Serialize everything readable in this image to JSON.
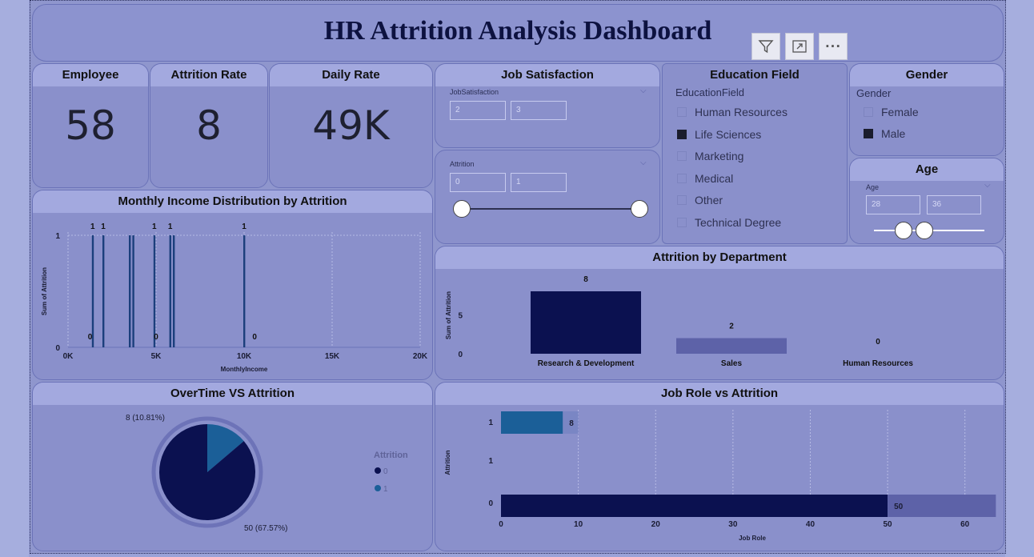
{
  "header": {
    "title": "HR Attrition Analysis Dashboard"
  },
  "toolbar": {
    "filter_icon": "filter-icon",
    "focus_icon": "expand-icon",
    "more_icon": "more-options-icon",
    "more_glyph": "···"
  },
  "kpis": [
    {
      "label": "Employee",
      "value": "58"
    },
    {
      "label": "Attrition Rate",
      "value": "8"
    },
    {
      "label": "Daily Rate",
      "value": "49K"
    }
  ],
  "job_satisfaction": {
    "title": "Job Satisfaction",
    "field_label": "JobSatisfaction",
    "min": "2",
    "max": "3"
  },
  "attrition_slicer": {
    "field_label": "Attrition",
    "min": "0",
    "max": "1"
  },
  "education": {
    "title": "Education Field",
    "field_label": "EducationField",
    "options": [
      {
        "label": "Human Resources",
        "checked": false
      },
      {
        "label": "Life Sciences",
        "checked": true
      },
      {
        "label": "Marketing",
        "checked": false
      },
      {
        "label": "Medical",
        "checked": false
      },
      {
        "label": "Other",
        "checked": false
      },
      {
        "label": "Technical Degree",
        "checked": false
      }
    ]
  },
  "gender": {
    "title": "Gender",
    "field_label": "Gender",
    "options": [
      {
        "label": "Female",
        "checked": false
      },
      {
        "label": "Male",
        "checked": true
      }
    ]
  },
  "age": {
    "title": "Age",
    "field_label": "Age",
    "min": "28",
    "max": "36"
  },
  "chart_data": [
    {
      "id": "income",
      "type": "bar",
      "title": "Monthly Income Distribution by Attrition",
      "xlabel": "MonthlyIncome",
      "ylabel": "Sum of Attrition",
      "xlim": [
        0,
        20000
      ],
      "ylim": [
        0,
        1
      ],
      "x_ticks": [
        "0K",
        "5K",
        "10K",
        "15K",
        "20K"
      ],
      "y_ticks": [
        "0",
        "1"
      ],
      "grid": true,
      "bars": [
        {
          "x": 1400,
          "value": 1,
          "label": "1"
        },
        {
          "x": 2000,
          "value": 1,
          "label": "1"
        },
        {
          "x": 3500,
          "value": 1,
          "label": ""
        },
        {
          "x": 3700,
          "value": 1,
          "label": ""
        },
        {
          "x": 4900,
          "value": 1,
          "label": "1"
        },
        {
          "x": 5800,
          "value": 1,
          "label": "1"
        },
        {
          "x": 6000,
          "value": 1,
          "label": ""
        },
        {
          "x": 10000,
          "value": 1,
          "label": "1"
        }
      ],
      "zero_labels": [
        {
          "x": 1250,
          "label": "0"
        },
        {
          "x": 5000,
          "label": "0"
        },
        {
          "x": 10600,
          "label": "0"
        }
      ]
    },
    {
      "id": "department",
      "type": "bar",
      "title": "Attrition by Department",
      "ylabel": "Sum of Attrition",
      "categories": [
        "Research & Development",
        "Sales",
        "Human Resources"
      ],
      "values": [
        8,
        2,
        0
      ],
      "ylim": [
        0,
        8
      ],
      "y_ticks": [
        0,
        5
      ],
      "colors": [
        "#0b1150",
        "#5d62a8",
        "#8a90cb"
      ]
    },
    {
      "id": "overtime",
      "type": "pie",
      "title": "OverTime VS Attrition",
      "legend_title": "Attrition",
      "legend_placement": "right",
      "slices": [
        {
          "name": "0",
          "value": 50,
          "label": "50 (67.57%)",
          "color": "#0b1150"
        },
        {
          "name": "1",
          "value": 8,
          "label": "8 (10.81%)",
          "color": "#1b5f98"
        }
      ]
    },
    {
      "id": "jobrole",
      "type": "bar",
      "orientation": "horizontal",
      "title": "Job Role vs Attrition",
      "xlabel": "Job Role",
      "ylabel": "Attrition",
      "xlim": [
        0,
        65
      ],
      "x_ticks": [
        0,
        10,
        20,
        30,
        40,
        50,
        60
      ],
      "y_ticks": [
        "1",
        "1",
        "0"
      ],
      "rows": [
        {
          "y": "1",
          "segments": [
            {
              "value": 8,
              "color": "#1b5f98"
            },
            {
              "value": 2,
              "color": "#7a86c4"
            }
          ],
          "label": "8"
        },
        {
          "y": "0",
          "segments": [
            {
              "value": 50,
              "color": "#0b1150"
            },
            {
              "value": 14,
              "color": "#5d62a8"
            }
          ],
          "label": "50"
        }
      ]
    }
  ]
}
